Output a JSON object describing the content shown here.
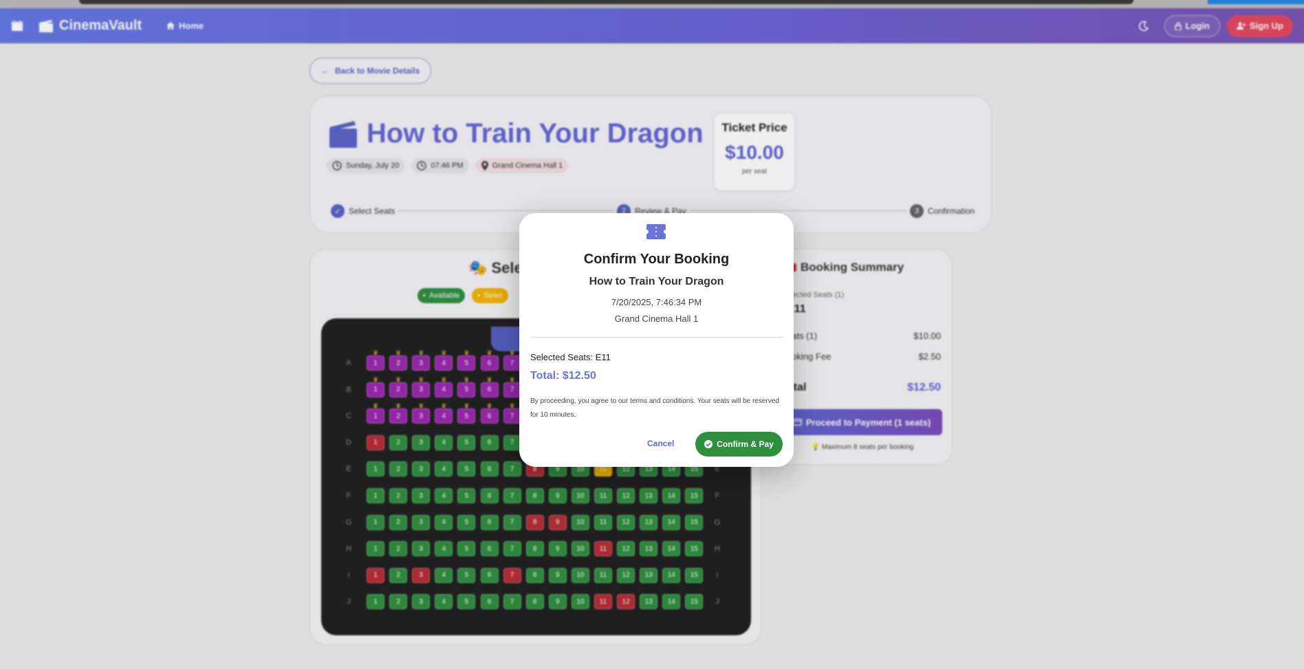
{
  "navbar": {
    "brand": "CinemaVault",
    "home_label": "Home",
    "login_label": "Login",
    "signup_label": "Sign Up"
  },
  "back_label": "Back to Movie Details",
  "movie": {
    "title": "How to Train Your Dragon",
    "date": "Sunday, July 20",
    "time": "07:46 PM",
    "hall": "Grand Cinema Hall 1",
    "price_label": "Ticket Price",
    "price_value": "$10.00",
    "price_sub": "per seat"
  },
  "steps": [
    {
      "num": "✓",
      "label": "Select Seats"
    },
    {
      "num": "2",
      "label": "Review & Pay"
    },
    {
      "num": "3",
      "label": "Confirmation"
    }
  ],
  "seat_section": {
    "heading": "🎭 Selec",
    "legend": [
      {
        "label": "Available",
        "color": "#2e8f3e"
      },
      {
        "label": "Selec",
        "color": "#f4b400"
      }
    ],
    "screen_label": "S",
    "rows": [
      "A",
      "B",
      "C",
      "D",
      "E",
      "F",
      "G",
      "H",
      "I",
      "J"
    ],
    "seats_per_row": 15,
    "vip_rows": [
      "A",
      "B",
      "C"
    ],
    "booked": {
      "D": [
        1
      ],
      "E": [
        8
      ],
      "G": [
        8,
        9
      ],
      "H": [
        11
      ],
      "I": [
        1,
        3,
        7
      ],
      "J": [
        11,
        12
      ]
    },
    "selected": {
      "E": [
        11
      ]
    }
  },
  "summary": {
    "title": "Booking Summary",
    "selected_label": "elected Seats (1)",
    "selected_seats": "E11",
    "seats_line_label": "eats (1)",
    "seats_line_value": "$10.00",
    "fee_label": "ooking Fee",
    "fee_value": "$2.50",
    "total_label": "otal",
    "total_value": "$12.50",
    "pay_button": "Proceed to Payment (1 seats)",
    "note": "💡 Maximum 8 seats per booking"
  },
  "modal": {
    "title": "Confirm Your Booking",
    "movie": "How to Train Your Dragon",
    "datetime": "7/20/2025, 7:46:34 PM",
    "hall": "Grand Cinema Hall 1",
    "selected_seats": "Selected Seats: E11",
    "total": "Total: $12.50",
    "terms": "By proceeding, you agree to our terms and conditions. Your seats will be reserved for 10 minutes.",
    "cancel_label": "Cancel",
    "confirm_label": "Confirm & Pay"
  }
}
